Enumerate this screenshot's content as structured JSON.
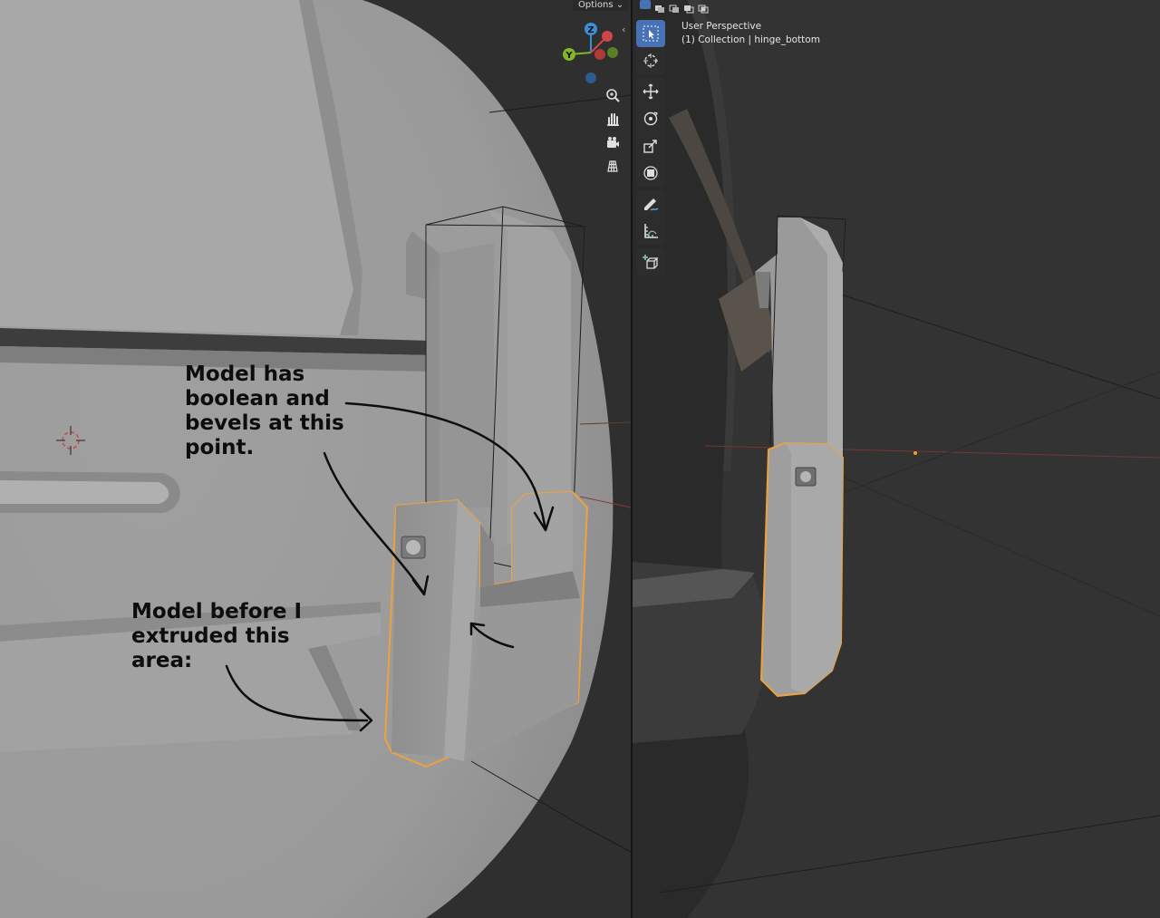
{
  "left_viewport": {
    "options_label": "Options",
    "gizmo": {
      "z": "Z",
      "y": "Y",
      "x": "X"
    },
    "nav_icons": [
      "zoom-icon",
      "pan-hand-icon",
      "camera-icon",
      "ortho-grid-icon"
    ],
    "annotations": {
      "top": "Model has\nboolean and\nbevels at this\npoint.",
      "bottom": "Model before I\nextruded this\narea:"
    }
  },
  "right_viewport": {
    "view_name": "User Perspective",
    "collection_info": "(1) Collection | hinge_bottom",
    "tools": [
      {
        "icon": "select-box-icon",
        "active": true
      },
      {
        "icon": "cursor-icon",
        "active": false
      },
      {
        "icon": "move-icon",
        "active": false
      },
      {
        "icon": "rotate-icon",
        "active": false
      },
      {
        "icon": "scale-icon",
        "active": false
      },
      {
        "icon": "transform-icon",
        "active": false
      },
      {
        "icon": "annotate-icon",
        "active": false
      },
      {
        "icon": "measure-icon",
        "active": false
      },
      {
        "icon": "add-cube-icon",
        "active": false
      }
    ],
    "select_modes": [
      "select-new-icon",
      "select-extend-icon",
      "select-subtract-icon",
      "select-invert-icon",
      "select-intersect-icon"
    ]
  },
  "colors": {
    "selection_outline": "#f0a23a",
    "active_tool": "#4772b3",
    "axis_x": "#d04545",
    "axis_y": "#85b628",
    "axis_z": "#3b8ed8",
    "viewport_bg": "#323232",
    "mesh": "#a5a5a5"
  }
}
